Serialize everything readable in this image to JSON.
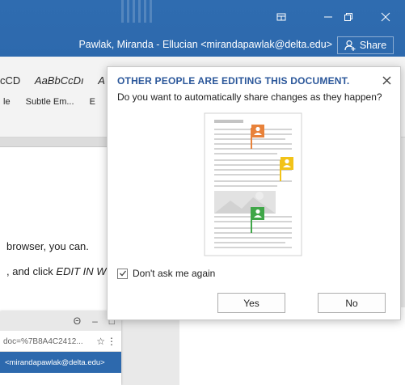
{
  "window": {
    "user_info": "Pawlak, Miranda - Ellucian <mirandapawlak@delta.edu>",
    "share_label": "Share"
  },
  "ribbon": {
    "styles_row1": [
      "cCD",
      "AaBbCcDı",
      "A"
    ],
    "styles_row2": [
      "le",
      "Subtle Em...",
      "E"
    ]
  },
  "document": {
    "line1": "browser, you can.",
    "line2_prefix": ", and click ",
    "line2_em": "EDIT IN W"
  },
  "inner_browser": {
    "controls": [
      "Θ",
      "–",
      "□"
    ],
    "url": "doc=%7B8A4C2412...",
    "email": "<mirandapawlak@delta.edu>"
  },
  "dialog": {
    "title": "OTHER PEOPLE ARE EDITING THIS DOCUMENT.",
    "description": "Do you want to automatically share changes as they happen?",
    "checkbox_label": "Don't ask me again",
    "checkbox_checked": true,
    "yes_label": "Yes",
    "no_label": "No",
    "flag_colors": [
      "#e8823a",
      "#f2c318",
      "#3fa648"
    ]
  }
}
